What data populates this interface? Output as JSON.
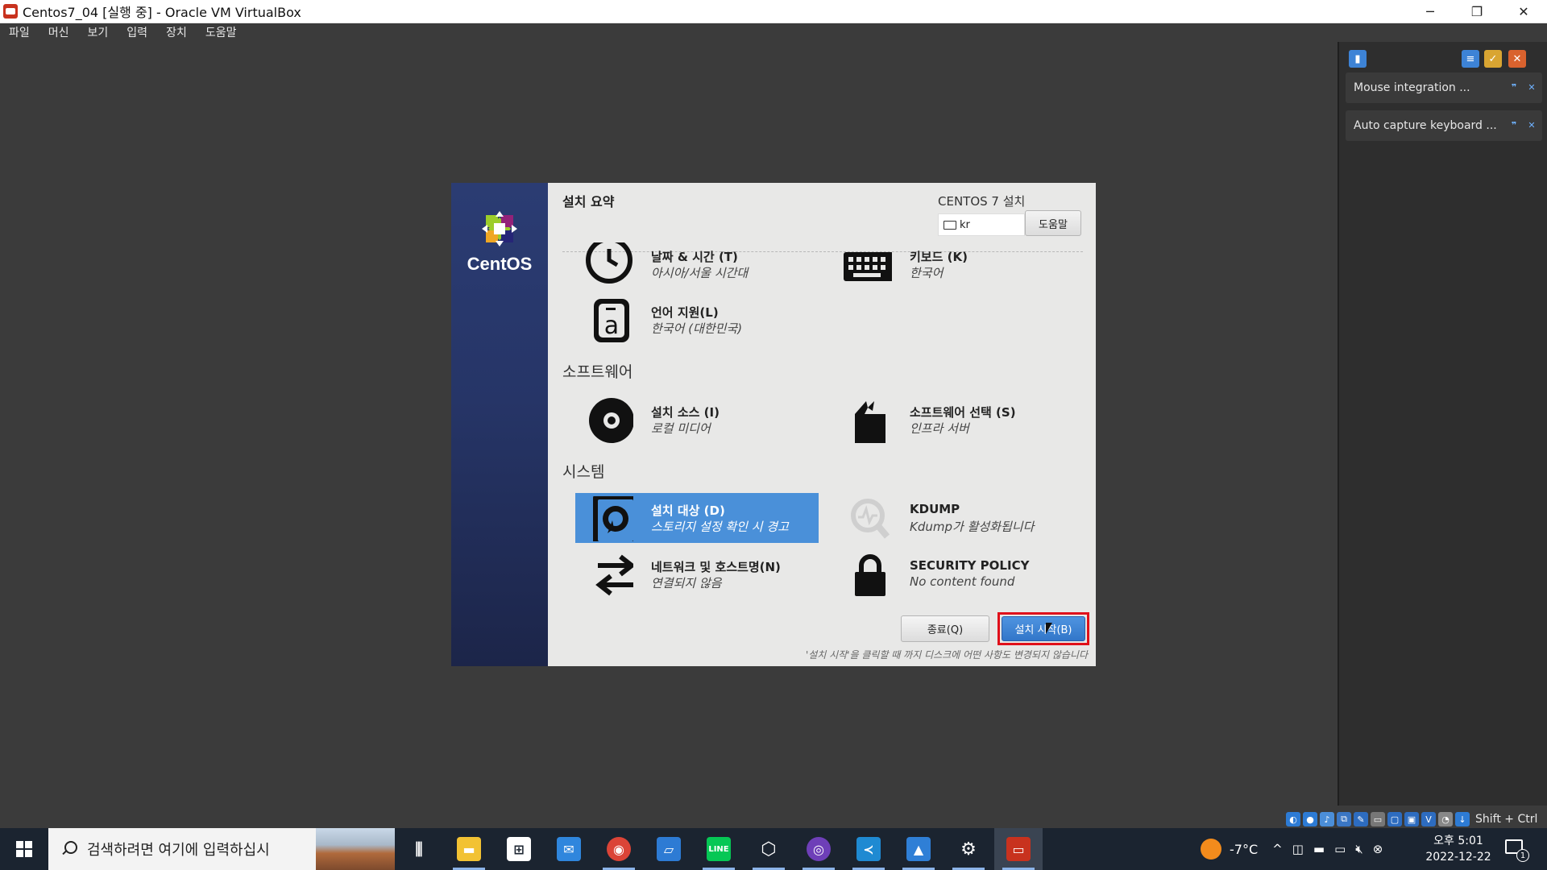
{
  "window": {
    "title": "Centos7_04 [실행 중] - Oracle VM VirtualBox",
    "controls": [
      "─",
      "❐",
      "✕"
    ]
  },
  "menu": [
    "파일",
    "머신",
    "보기",
    "입력",
    "장치",
    "도움말"
  ],
  "notifications": [
    {
      "text": "Mouse integration ..."
    },
    {
      "text": "Auto capture keyboard ..."
    }
  ],
  "installer": {
    "sidebar_brand": "CentOS",
    "summary_title": "설치 요약",
    "product_title": "CENTOS 7 설치",
    "keyboard_layout": "kr",
    "help_button": "도움말",
    "sections": {
      "software": "소프트웨어",
      "system": "시스템"
    },
    "spokes": {
      "datetime": {
        "name": "날짜 & 시간 (T)",
        "status": "아시아/서울 시간대",
        "icon": "clock-icon"
      },
      "keyboard": {
        "name": "키보드 (K)",
        "status": "한국어",
        "icon": "keyboard-icon"
      },
      "language": {
        "name": "언어 지원(L)",
        "status": "한국어 (대한민국)",
        "icon": "language-icon"
      },
      "source": {
        "name": "설치 소스 (I)",
        "status": "로컬 미디어",
        "icon": "disc-icon"
      },
      "software": {
        "name": "소프트웨어 선택 (S)",
        "status": "인프라 서버",
        "icon": "package-icon"
      },
      "destination": {
        "name": "설치 대상 (D)",
        "status": "스토리지 설정 확인 시 경고",
        "icon": "disk-icon"
      },
      "kdump": {
        "name": "KDUMP",
        "status": "Kdump가 활성화됩니다",
        "icon": "search-icon"
      },
      "network": {
        "name": "네트워크 및 호스트명(N)",
        "status": "연결되지 않음",
        "icon": "network-arrows-icon"
      },
      "security": {
        "name": "SECURITY POLICY",
        "status": "No content found",
        "icon": "lock-icon"
      }
    },
    "quit_button": "종료(Q)",
    "begin_button": "설치 시작(B)",
    "footer_note": "'설치 시작'을 클릭할 때 까지 디스크에 어떤 사항도 변경되지 않습니다"
  },
  "vbox_status": {
    "host_key": "Shift + Ctrl"
  },
  "taskbar": {
    "search_placeholder": "검색하려면 여기에 입력하십시",
    "apps": [
      "task-view",
      "file-explorer",
      "store",
      "mail",
      "chrome",
      "remote-desktop",
      "line",
      "virtualbox-3d",
      "github",
      "vscode",
      "photos",
      "settings",
      "virtualbox"
    ],
    "weather": "-7°C",
    "time": "오후 5:01",
    "date": "2022-12-22",
    "notification_count": "1"
  },
  "colors": {
    "accent": "#4a90d9",
    "highlight_border": "#e0101a",
    "sidebar": "#263567"
  }
}
